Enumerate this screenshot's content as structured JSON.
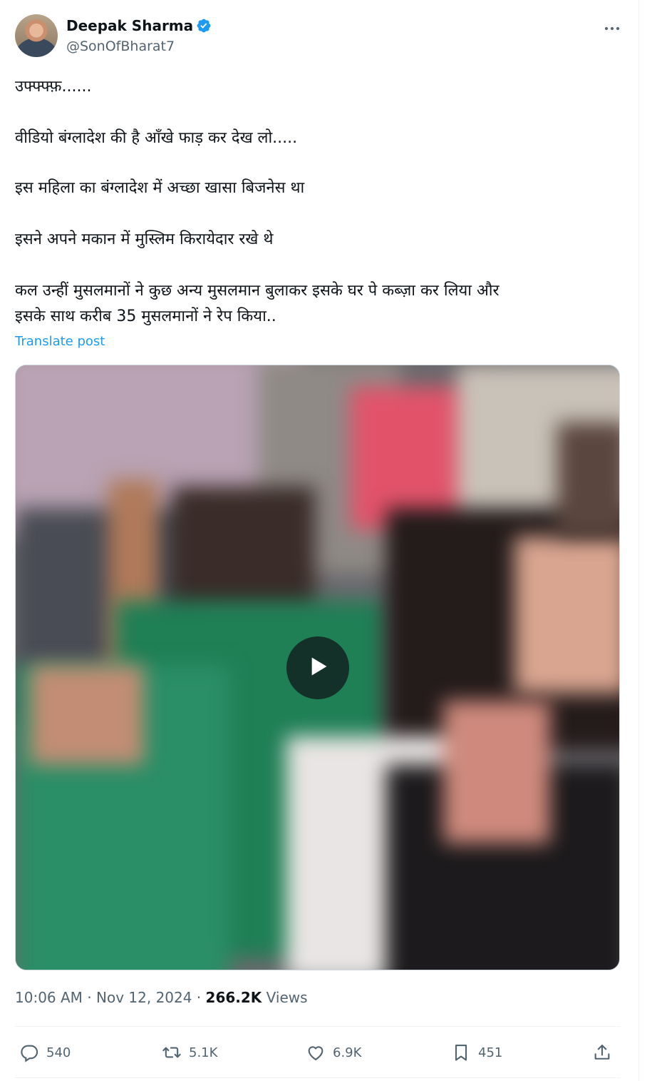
{
  "author": {
    "display_name": "Deepak Sharma",
    "handle": "@SonOfBharat7",
    "verified": true
  },
  "post": {
    "lines": [
      "उफ्फ्फ्फ़......",
      "वीडियो बंग्लादेश की है आँखे फाड़ कर देख लो.....",
      "इस महिला का बंग्लादेश में अच्छा खासा बिजनेस था",
      "इसने अपने मकान में मुस्लिम किरायेदार रखे थे",
      "कल उन्हीं मुसलमानों ने कुछ अन्य मुसलमान बुलाकर इसके घर पे कब्ज़ा कर लिया और",
      "इसके साथ करीब 35 मुसलमानों ने रेप किया.."
    ],
    "translate_label": "Translate post"
  },
  "meta": {
    "time": "10:06 AM",
    "separator": "·",
    "date": "Nov 12, 2024",
    "views_count": "266.2K",
    "views_label": "Views"
  },
  "actions": {
    "replies": "540",
    "reposts": "5.1K",
    "likes": "6.9K",
    "bookmarks": "451"
  },
  "colors": {
    "accent": "#1d9bf0",
    "text": "#0f1419",
    "muted": "#536471"
  }
}
